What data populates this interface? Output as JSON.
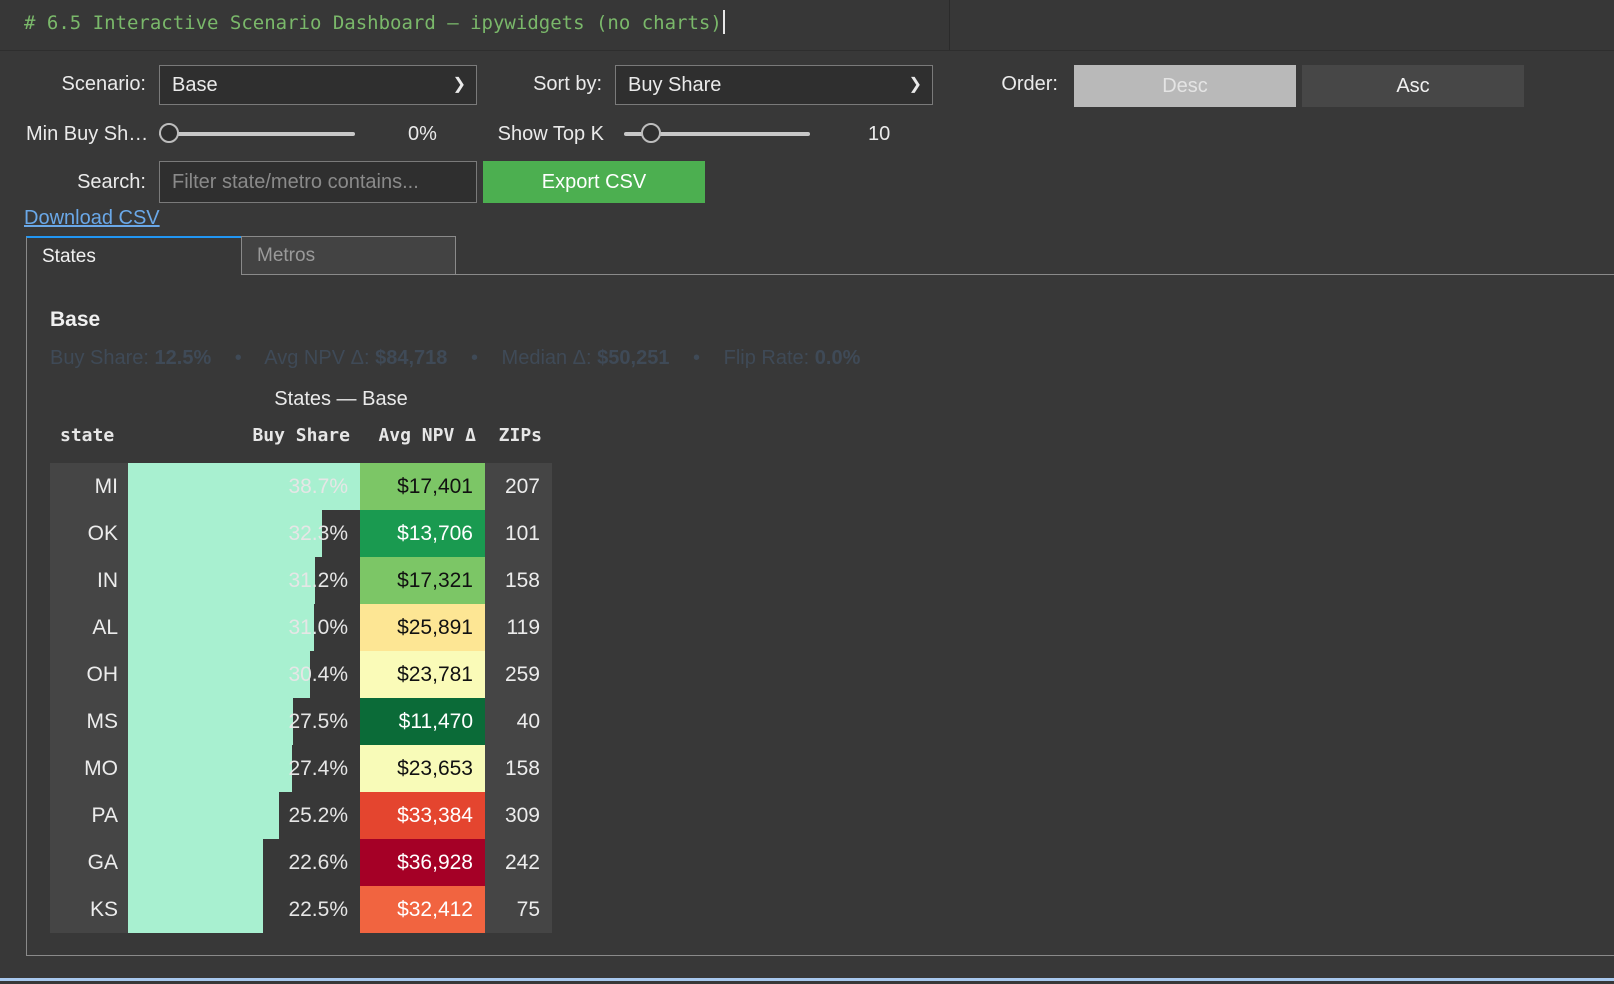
{
  "code_cell": {
    "text": "# 6.5 Interactive Scenario Dashboard — ipywidgets (no charts)"
  },
  "controls": {
    "scenario_label": "Scenario:",
    "scenario_value": "Base",
    "sort_label": "Sort by:",
    "sort_value": "Buy Share",
    "order_label": "Order:",
    "order_desc": "Desc",
    "order_asc": "Asc",
    "order_selected": "Desc",
    "min_buy_label": "Min Buy Sh…",
    "min_buy_value": "0%",
    "min_buy_fraction": 0,
    "topk_label": "Show Top K",
    "topk_value": "10",
    "topk_fraction": 0.1,
    "search_label": "Search:",
    "search_placeholder": "Filter state/metro contains...",
    "search_value": "",
    "export_label": "Export CSV",
    "download_link": "Download CSV"
  },
  "tabs": [
    {
      "label": "States",
      "active": true
    },
    {
      "label": "Metros",
      "active": false
    }
  ],
  "panel": {
    "title": "Base",
    "stats": {
      "buy_share_label": "Buy Share:",
      "buy_share_value": "12.5%",
      "avg_npv_label": "Avg NPV Δ:",
      "avg_npv_value": "$84,718",
      "median_label": "Median Δ:",
      "median_value": "$50,251",
      "flip_label": "Flip Rate:",
      "flip_value": "0.0%",
      "separator": "•"
    }
  },
  "table": {
    "caption": "States — Base",
    "headers": {
      "state": "state",
      "buy_share": "Buy Share",
      "avg_npv": "Avg NPV Δ",
      "zips": "ZIPs"
    },
    "rows": [
      {
        "state": "MI",
        "buy_share": "38.7%",
        "share_num": 38.7,
        "avg_npv": "$17,401",
        "zips": "207",
        "npv_color": "#7cc666",
        "npv_text": "#111111"
      },
      {
        "state": "OK",
        "buy_share": "32.3%",
        "share_num": 32.3,
        "avg_npv": "$13,706",
        "zips": "101",
        "npv_color": "#1a9a50",
        "npv_text": "#ffffff"
      },
      {
        "state": "IN",
        "buy_share": "31.2%",
        "share_num": 31.2,
        "avg_npv": "$17,321",
        "zips": "158",
        "npv_color": "#7cc666",
        "npv_text": "#111111"
      },
      {
        "state": "AL",
        "buy_share": "31.0%",
        "share_num": 31.0,
        "avg_npv": "$25,891",
        "zips": "119",
        "npv_color": "#fde694",
        "npv_text": "#111111"
      },
      {
        "state": "OH",
        "buy_share": "30.4%",
        "share_num": 30.4,
        "avg_npv": "$23,781",
        "zips": "259",
        "npv_color": "#fafbb8",
        "npv_text": "#111111"
      },
      {
        "state": "MS",
        "buy_share": "27.5%",
        "share_num": 27.5,
        "avg_npv": "$11,470",
        "zips": "40",
        "npv_color": "#0b6b38",
        "npv_text": "#ffffff"
      },
      {
        "state": "MO",
        "buy_share": "27.4%",
        "share_num": 27.4,
        "avg_npv": "$23,653",
        "zips": "158",
        "npv_color": "#f8fbb8",
        "npv_text": "#111111"
      },
      {
        "state": "PA",
        "buy_share": "25.2%",
        "share_num": 25.2,
        "avg_npv": "$33,384",
        "zips": "309",
        "npv_color": "#e4452f",
        "npv_text": "#ffffff"
      },
      {
        "state": "GA",
        "buy_share": "22.6%",
        "share_num": 22.6,
        "avg_npv": "$36,928",
        "zips": "242",
        "npv_color": "#a50026",
        "npv_text": "#ffffff"
      },
      {
        "state": "KS",
        "buy_share": "22.5%",
        "share_num": 22.5,
        "avg_npv": "$32,412",
        "zips": "75",
        "npv_color": "#f16440",
        "npv_text": "#ffffff"
      }
    ]
  },
  "colors": {
    "accent_tab": "#2196f3",
    "export_button": "#4caf50",
    "bar_fill": "#a8f0d0",
    "link": "#6aa8e8"
  }
}
